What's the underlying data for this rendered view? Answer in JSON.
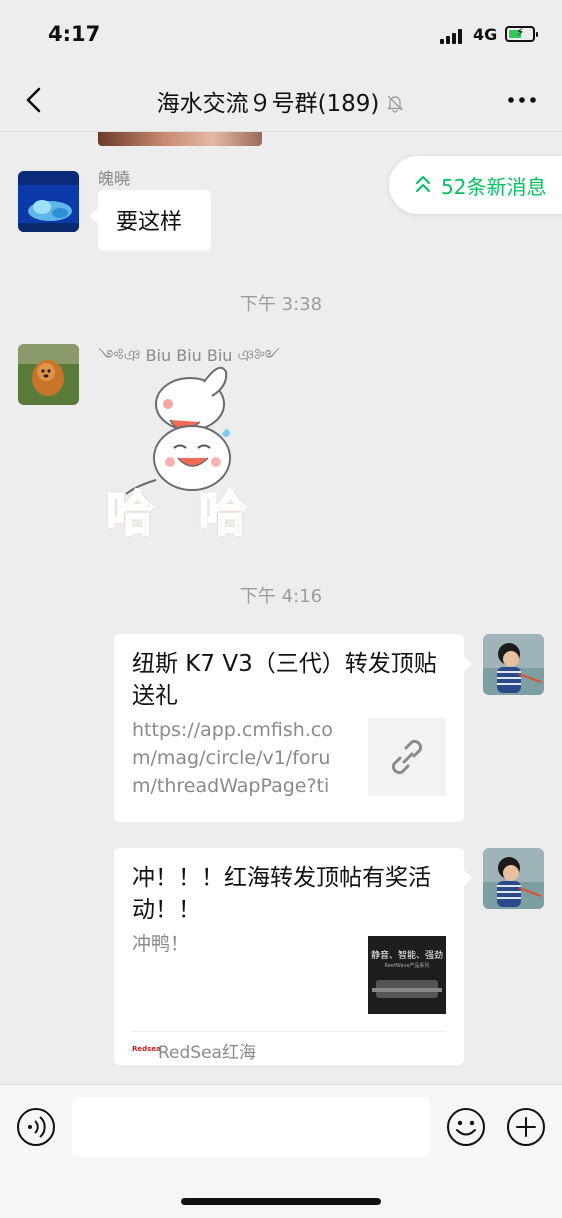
{
  "status_bar": {
    "time": "4:17",
    "network": "4G",
    "battery_percent": 55
  },
  "header": {
    "title": "海水交流９号群(189)",
    "muted": true
  },
  "new_messages": {
    "label": "52条新消息"
  },
  "messages": [
    {
      "type": "text",
      "side": "left",
      "sender": "魄曉",
      "text": "要这样",
      "avatar_icon": "aquarium-coral-avatar"
    },
    {
      "type": "time",
      "text": "下午 3:38"
    },
    {
      "type": "sticker",
      "side": "left",
      "sender": "༺ঞ Biu Biu Biu ঞ༻",
      "sticker_text": "哈 哈",
      "avatar_icon": "dog-avatar"
    },
    {
      "type": "time",
      "text": "下午 4:16"
    },
    {
      "type": "link",
      "side": "right",
      "title": "纽斯 K7 V3（三代）转发顶贴送礼",
      "desc": "https://app.cmfish.com/mag/circle/v1/forum/threadWapPage?tid...",
      "thumb_icon": "link-icon",
      "avatar_icon": "child-avatar"
    },
    {
      "type": "link",
      "side": "right",
      "title": "冲！！！红海转发顶帖有奖活动！！",
      "desc": "冲鸭！",
      "thumb_text": "静音、智能、强劲",
      "thumb_subtext": "ReefWave产品系列",
      "source_logo": "Redsea",
      "source": "RedSea红海",
      "avatar_icon": "child-avatar"
    }
  ],
  "input": {
    "placeholder": ""
  }
}
